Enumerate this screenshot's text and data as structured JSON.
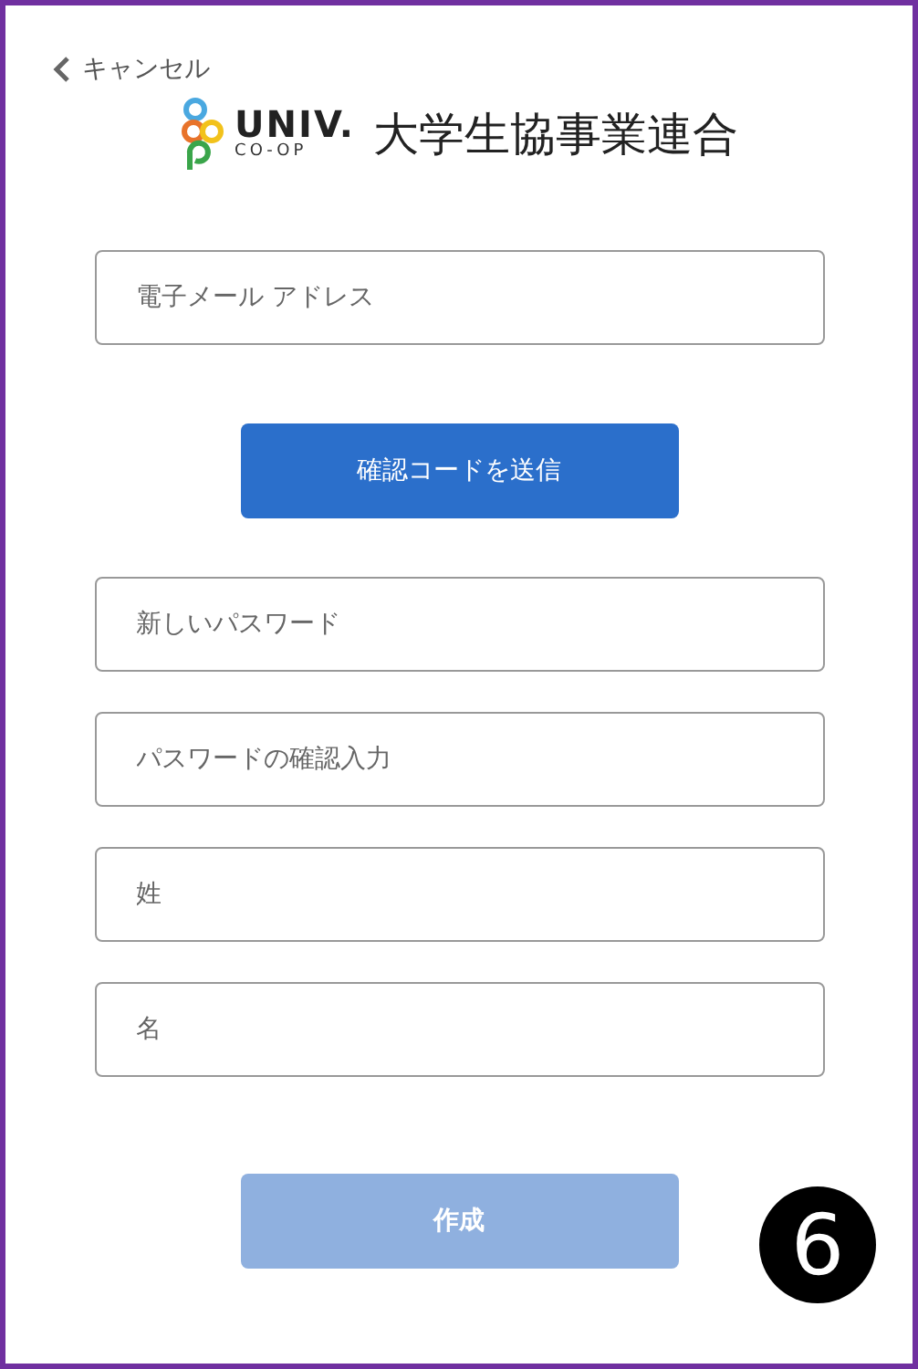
{
  "cancel_link": {
    "label": "キャンセル"
  },
  "logo": {
    "wordmark": "UNIV.",
    "subline": "CO-OP",
    "org_name": "大学生協事業連合"
  },
  "email_field": {
    "placeholder": "電子メール アドレス"
  },
  "send_code_button": {
    "label": "確認コードを送信",
    "disabled": false
  },
  "fields": [
    {
      "placeholder": "新しいパスワード"
    },
    {
      "placeholder": "パスワードの確認入力"
    },
    {
      "placeholder": "姓"
    },
    {
      "placeholder": "名"
    }
  ],
  "create_button": {
    "label": "作成",
    "disabled": true
  },
  "step_badge": {
    "label": "6"
  }
}
